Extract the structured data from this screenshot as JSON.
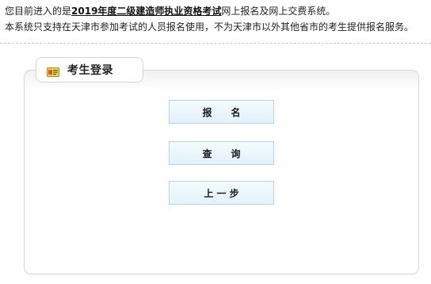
{
  "intro": {
    "line1_prefix": "您目前进入的是",
    "line1_emphasis": "2019年度二级建造师执业资格考试",
    "line1_suffix": "网上报名及网上交费系统。",
    "line2": "本系统只支持在天津市参加考试的人员报名使用，不为天津市以外其他省市的考生提供报名服务。"
  },
  "panel": {
    "title": "考生登录",
    "icon": "id-card-icon"
  },
  "buttons": {
    "register": "报　　名",
    "query": "查　　询",
    "back": "上 一 步"
  },
  "colors": {
    "button_border": "#b7d3e5",
    "button_fill": "#e2f1fb",
    "icon_yellow": "#f2d35b",
    "panel_border": "#d6d6d6"
  }
}
